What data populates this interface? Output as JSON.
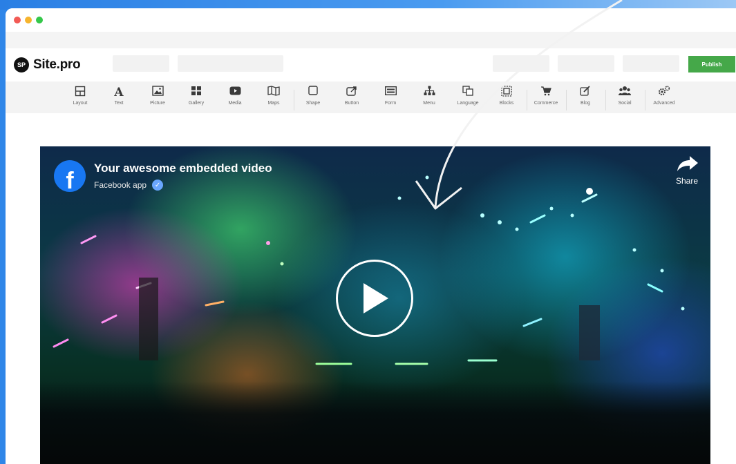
{
  "window": {
    "dots": [
      "close",
      "minimize",
      "maximize"
    ]
  },
  "header": {
    "logo_badge": "SP",
    "logo_text": "Site.pro",
    "publish_label": "Publish"
  },
  "toolbar": {
    "items": [
      {
        "label": "Layout",
        "icon": "layout-icon"
      },
      {
        "label": "Text",
        "icon": "text-icon"
      },
      {
        "label": "Picture",
        "icon": "picture-icon"
      },
      {
        "label": "Gallery",
        "icon": "gallery-icon"
      },
      {
        "label": "Media",
        "icon": "media-icon"
      },
      {
        "label": "Maps",
        "icon": "maps-icon"
      },
      {
        "label": "Shape",
        "icon": "shape-icon"
      },
      {
        "label": "Button",
        "icon": "button-icon"
      },
      {
        "label": "Form",
        "icon": "form-icon"
      },
      {
        "label": "Menu",
        "icon": "menu-icon"
      },
      {
        "label": "Language",
        "icon": "language-icon"
      },
      {
        "label": "Blocks",
        "icon": "blocks-icon"
      },
      {
        "label": "Commerce",
        "icon": "cart-icon"
      },
      {
        "label": "Blog",
        "icon": "blog-icon"
      },
      {
        "label": "Social",
        "icon": "social-icon"
      },
      {
        "label": "Advanced",
        "icon": "gears-icon"
      }
    ]
  },
  "video": {
    "title": "Your awesome embedded video",
    "subtitle": "Facebook app",
    "share_label": "Share",
    "fb_letter": "f"
  },
  "colors": {
    "accent_publish": "#45a849",
    "facebook_blue": "#1877f2",
    "background_blue": "#2f86e8"
  }
}
